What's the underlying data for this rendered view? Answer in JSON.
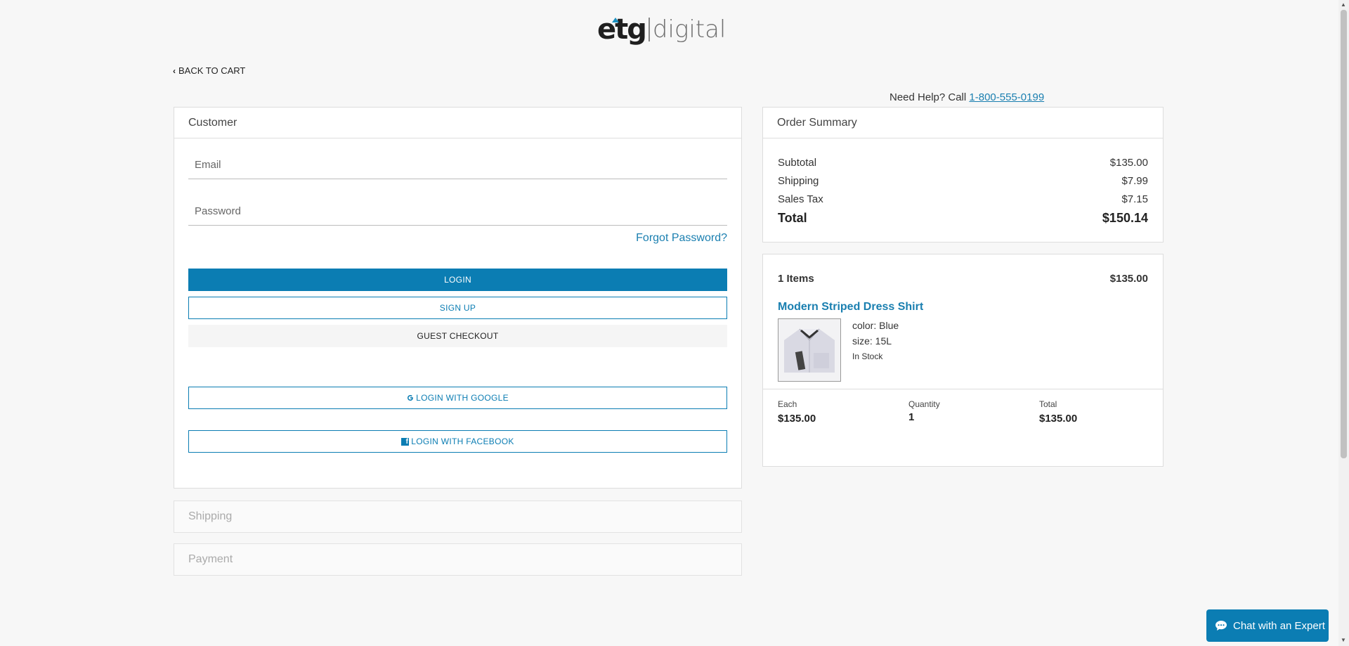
{
  "brand": {
    "logo_main": "etg",
    "logo_sub": "digital",
    "accent": "#0b7db3"
  },
  "nav": {
    "back_label": "BACK TO CART"
  },
  "help": {
    "prefix": "Need Help? Call ",
    "phone": "1-800-555-0199"
  },
  "customer": {
    "title": "Customer",
    "email_placeholder": "Email",
    "password_placeholder": "Password",
    "forgot_label": "Forgot Password?",
    "login_label": "LOGIN",
    "signup_label": "SIGN UP",
    "guest_label": "GUEST CHECKOUT",
    "google_label": "LOGIN WITH GOOGLE",
    "facebook_label": "LOGIN WITH FACEBOOK"
  },
  "sections": {
    "shipping": "Shipping",
    "payment": "Payment"
  },
  "order_summary": {
    "title": "Order Summary",
    "rows": [
      {
        "label": "Subtotal",
        "value": "$135.00"
      },
      {
        "label": "Shipping",
        "value": "$7.99"
      },
      {
        "label": "Sales Tax",
        "value": "$7.15"
      }
    ],
    "total_label": "Total",
    "total_value": "$150.14"
  },
  "cart": {
    "items_label": "1 Items",
    "items_total": "$135.00",
    "product": {
      "name": "Modern Striped Dress Shirt",
      "color": "color: Blue",
      "size": "size: 15L",
      "stock": "In Stock"
    },
    "each_label": "Each",
    "each_value": "$135.00",
    "qty_label": "Quantity",
    "qty_value": "1",
    "total_label": "Total",
    "total_value": "$135.00"
  },
  "chat": {
    "label": "Chat with an Expert"
  }
}
